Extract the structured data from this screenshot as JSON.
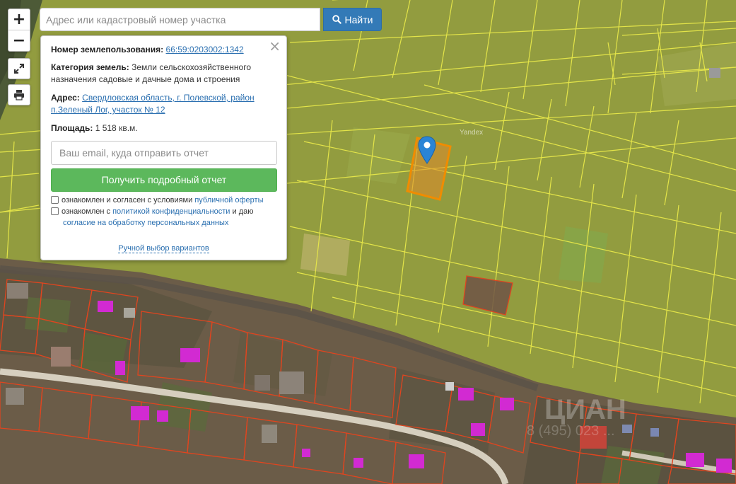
{
  "map": {
    "provider_label": "Yandex",
    "watermark": "ЦИАН",
    "watermark_sub": "8 (495) 023 ..."
  },
  "controls": {
    "zoom_in": "+",
    "zoom_out": "−"
  },
  "search": {
    "placeholder": "Адрес или кадастровый номер участка",
    "value": "",
    "button_label": "Найти"
  },
  "panel": {
    "cadastral_label": "Номер землепользования:",
    "cadastral_value": "66:59:0203002:1342",
    "category_label": "Категория земель:",
    "category_value": "Земли сельскохозяйственного назначения садовые и дачные дома и строения",
    "address_label": "Адрес:",
    "address_value": "Свердловская область, г. Полевской, район п.Зеленый Лог, участок № 12",
    "area_label": "Площадь:",
    "area_value": "1 518 кв.м.",
    "email_placeholder": "Ваш email, куда отправить отчет",
    "report_button": "Получить подробный отчет",
    "consent1_text": "ознакомлен и согласен с условиями ",
    "consent1_link": "публичной оферты",
    "consent2_text": "ознакомлен с ",
    "consent2_link": "политикой конфиденциальности",
    "consent2_mid": " и даю",
    "consent2_link2": "согласие на обработку персональных данных",
    "manual_choice": "Ручной выбор вариантов"
  },
  "colors": {
    "parcel_line": "#e8e84a",
    "built_parcel_line": "#e0451f",
    "selected_parcel": "#f08c00",
    "marker": "#2a84d6",
    "search_button": "#337ab7",
    "report_button": "#5cb85c"
  }
}
